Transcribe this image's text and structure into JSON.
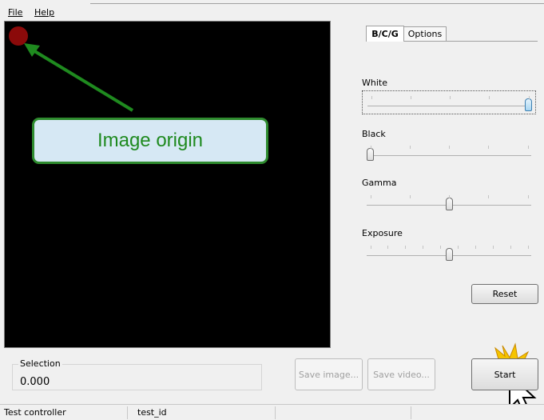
{
  "menu": {
    "file": "File",
    "help": "Help"
  },
  "annotation": {
    "label": "Image origin",
    "colors": {
      "arrow": "#1f8a1f",
      "origin_dot": "#8b0a0a",
      "box_fill": "#d6e8f4"
    }
  },
  "tabs": [
    {
      "label": "B/C/G",
      "selected": true
    },
    {
      "label": "Options",
      "selected": false
    }
  ],
  "sliders": {
    "white": {
      "label": "White",
      "value": 1.0
    },
    "black": {
      "label": "Black",
      "value": 0.0
    },
    "gamma": {
      "label": "Gamma",
      "value": 0.5
    },
    "exposure": {
      "label": "Exposure",
      "value": 0.5
    }
  },
  "buttons": {
    "reset": "Reset",
    "save_image": "Save image...",
    "save_video": "Save video...",
    "start": "Start"
  },
  "selection": {
    "label": "Selection",
    "value": "0.000"
  },
  "status": {
    "left": "Test controller",
    "middle": "test_id"
  }
}
